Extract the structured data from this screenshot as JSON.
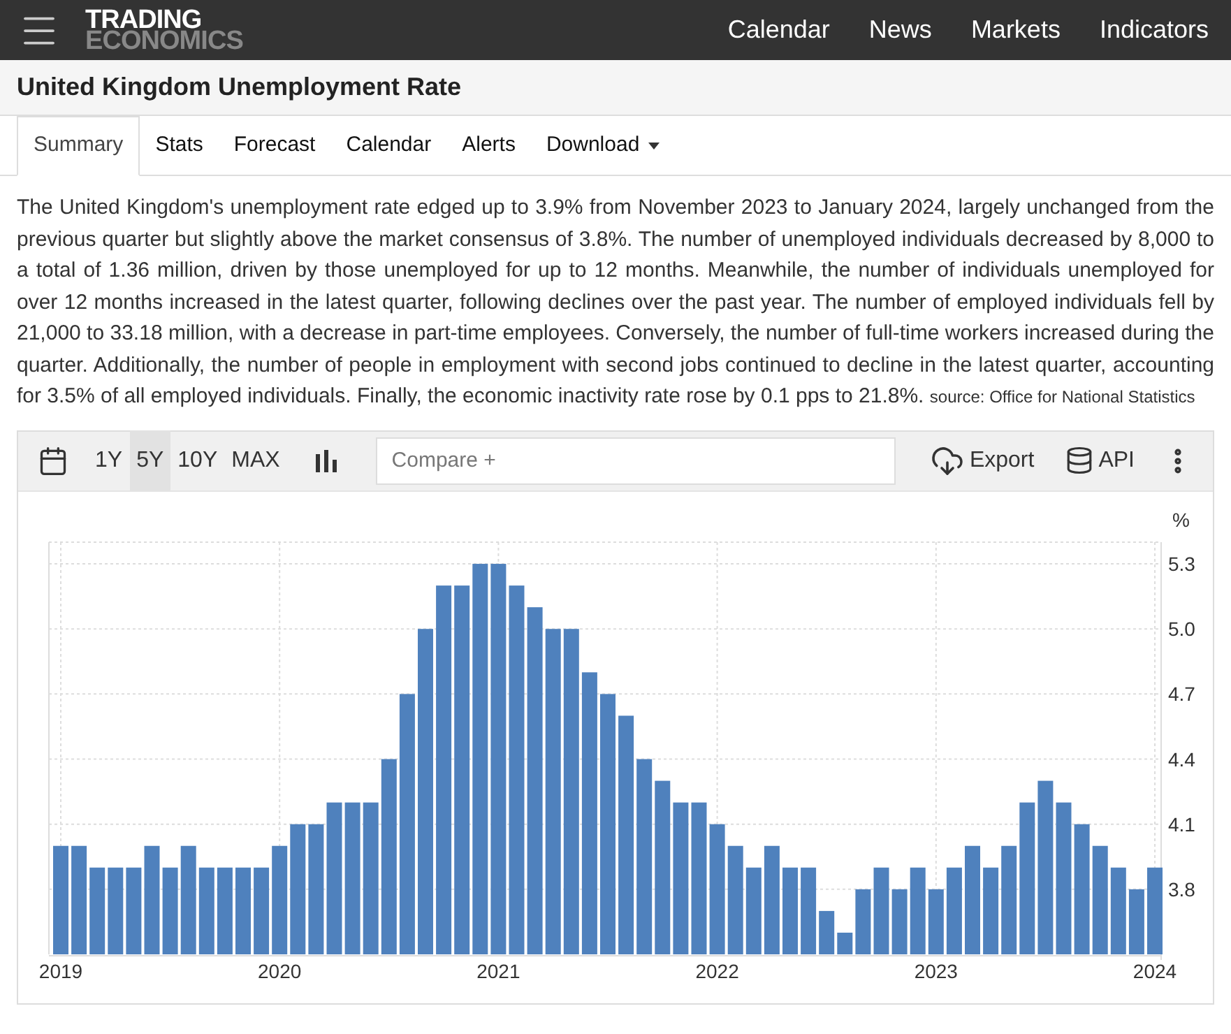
{
  "header": {
    "logo": [
      "TRADING",
      "ECONOMICS"
    ],
    "nav": [
      "Calendar",
      "News",
      "Markets",
      "Indicators"
    ]
  },
  "title": "United Kingdom Unemployment Rate",
  "tabs": [
    {
      "label": "Summary",
      "selected": true
    },
    {
      "label": "Stats",
      "selected": false
    },
    {
      "label": "Forecast",
      "selected": false
    },
    {
      "label": "Calendar",
      "selected": false
    },
    {
      "label": "Alerts",
      "selected": false
    },
    {
      "label": "Download",
      "selected": false,
      "kind": "dropdown"
    }
  ],
  "summary": {
    "text": "The United Kingdom's unemployment rate edged up to 3.9% from November 2023 to January 2024, largely unchanged from the previous quarter but slightly above the market consensus of 3.8%. The number of unemployed individuals decreased by 8,000 to a total of 1.36 million, driven by those unemployed for up to 12 months. Meanwhile, the number of individuals unemployed for over 12 months increased in the latest quarter, following declines over the past year. The number of employed individuals fell by 21,000 to 33.18 million, with a decrease in part-time employees. Conversely, the number of full-time workers increased during the quarter. Additionally, the number of people in employment with second jobs continued to decline in the latest quarter, accounting for 3.5% of all employed individuals. Finally, the economic inactivity rate rose by 0.1 pps to 21.8%.",
    "source": "source: Office for National Statistics"
  },
  "toolbar": {
    "ranges": [
      {
        "label": "1Y",
        "selected": false
      },
      {
        "label": "5Y",
        "selected": true
      },
      {
        "label": "10Y",
        "selected": false
      },
      {
        "label": "MAX",
        "selected": false
      }
    ],
    "compare_placeholder": "Compare +",
    "export": "Export",
    "api": "API"
  },
  "chart_data": {
    "type": "bar",
    "ylabel": "%",
    "categories": [
      "2019",
      null,
      null,
      null,
      null,
      null,
      null,
      null,
      null,
      null,
      null,
      null,
      "2020",
      null,
      null,
      null,
      null,
      null,
      null,
      null,
      null,
      null,
      null,
      null,
      "2021",
      null,
      null,
      null,
      null,
      null,
      null,
      null,
      null,
      null,
      null,
      null,
      "2022",
      null,
      null,
      null,
      null,
      null,
      null,
      null,
      null,
      null,
      null,
      null,
      "2023",
      null,
      null,
      null,
      null,
      null,
      null,
      null,
      null,
      null,
      null,
      null,
      "2024"
    ],
    "series": [
      {
        "color": "#4f81bd",
        "values": [
          4.0,
          4.0,
          3.9,
          3.9,
          3.9,
          4.0,
          3.9,
          4.0,
          3.9,
          3.9,
          3.9,
          3.9,
          4.0,
          4.1,
          4.1,
          4.2,
          4.2,
          4.2,
          4.4,
          4.7,
          5.0,
          5.2,
          5.2,
          5.3,
          5.3,
          5.2,
          5.1,
          5.0,
          5.0,
          4.8,
          4.7,
          4.6,
          4.4,
          4.3,
          4.2,
          4.2,
          4.1,
          4.0,
          3.9,
          4.0,
          3.9,
          3.9,
          3.7,
          3.6,
          3.8,
          3.9,
          3.8,
          3.9,
          3.8,
          3.9,
          4.0,
          3.9,
          4.0,
          4.2,
          4.3,
          4.2,
          4.1,
          4.0,
          3.9,
          3.8,
          3.9
        ]
      }
    ],
    "grid": true,
    "ylim": [
      3.5,
      5.4
    ],
    "yticks": [
      {
        "value": 3.8,
        "label": "3.8"
      },
      {
        "value": 4.1,
        "label": "4.1"
      },
      {
        "value": 4.4,
        "label": "4.4"
      },
      {
        "value": 4.7,
        "label": "4.7"
      },
      {
        "value": 5.0,
        "label": "5.0"
      },
      {
        "value": 5.3,
        "label": "5.3"
      }
    ]
  }
}
